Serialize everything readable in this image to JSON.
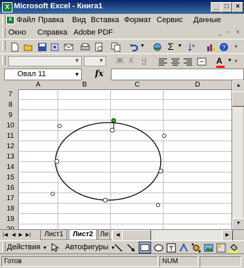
{
  "window": {
    "title": "Microsoft Excel - Книга1",
    "minimize": "_",
    "maximize": "□",
    "close": "×"
  },
  "menu_row1": [
    "Файл",
    "Правка",
    "Вид",
    "Вставка",
    "Формат",
    "Сервис",
    "Данные"
  ],
  "menu_row2": [
    "Окно",
    "Справка",
    "Adobe PDF"
  ],
  "name_box": {
    "value": "Овал 11"
  },
  "formula_bar": {
    "fx": "fx",
    "value": ""
  },
  "columns": [
    "A",
    "B",
    "C",
    "D"
  ],
  "rows": [
    "7",
    "8",
    "9",
    "10",
    "11",
    "12",
    "13",
    "14",
    "15",
    "16",
    "17",
    "18",
    "19",
    "20"
  ],
  "sheet_tabs": {
    "tabs": [
      "Лист1",
      "Лист2",
      "Ли"
    ],
    "active": "Лист2"
  },
  "draw_toolbar": {
    "actions_label": "Действия",
    "autoshapes_label": "Автофигуры"
  },
  "status": {
    "left": "Готов",
    "num": "NUM"
  },
  "colors": {
    "title_start": "#0a246a",
    "title_end": "#3a6ea5",
    "rotation_handle": "#22aa22",
    "font_color_bar": "#ff0000",
    "fill_color_bar": "#ffff00"
  }
}
